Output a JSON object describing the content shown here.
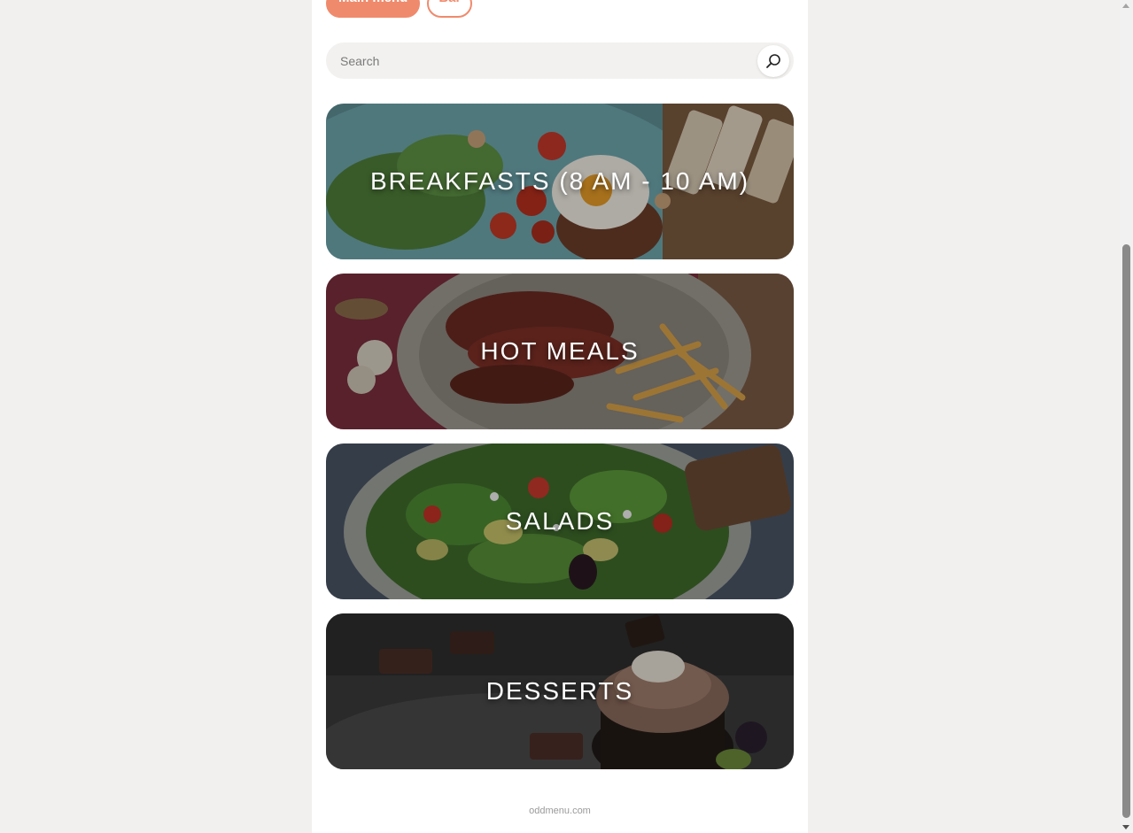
{
  "tabs": [
    {
      "label": "Main menu",
      "active": true
    },
    {
      "label": "Bar",
      "active": false
    }
  ],
  "search": {
    "placeholder": "Search"
  },
  "categories": [
    {
      "label": "BREAKFASTS (8 AM - 10 AM)"
    },
    {
      "label": "HOT MEALS"
    },
    {
      "label": "SALADS"
    },
    {
      "label": "DESSERTS"
    }
  ],
  "footer": {
    "text": "oddmenu.com"
  },
  "colors": {
    "accent": "#f08a6c",
    "background": "#f1f0ee",
    "page": "#ffffff"
  },
  "icons": {
    "search": "search-icon"
  }
}
